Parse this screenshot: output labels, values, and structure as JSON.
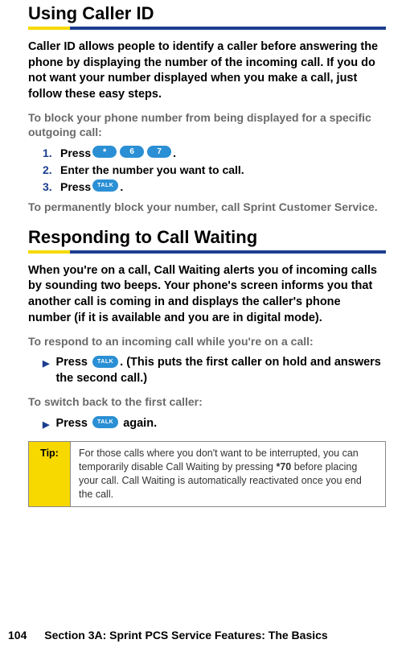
{
  "section1": {
    "heading": "Using Caller ID",
    "para": "Caller ID allows people to identify a caller before answering the phone by displaying the number of the incoming call. If you do not want your number displayed when you make a call, just follow these easy steps.",
    "subhead": "To block your phone number from being displayed for a specific outgoing call:",
    "steps": [
      {
        "num": "1.",
        "pre": "Press ",
        "keys": [
          "*",
          "6",
          "7"
        ],
        "post": "."
      },
      {
        "num": "2.",
        "pre": "Enter the number you want to call.",
        "keys": [],
        "post": ""
      },
      {
        "num": "3.",
        "pre": "Press ",
        "keys": [
          "TALK"
        ],
        "post": "."
      }
    ],
    "closing": "To permanently block your number, call Sprint Customer Service."
  },
  "section2": {
    "heading": "Responding to Call Waiting",
    "para": "When you're on a call, Call Waiting alerts you of incoming calls by sounding two beeps. Your phone's screen informs you that another call is coming in and displays the caller's phone number (if it is available and you are in digital mode).",
    "subhead1": "To respond to an incoming call while you're on a call:",
    "bullet1_pre": "Press ",
    "bullet1_key": "TALK",
    "bullet1_post": ". (This puts the first caller on hold and answers the second call.)",
    "subhead2": "To switch back to the first caller:",
    "bullet2_pre": "Press ",
    "bullet2_key": "TALK",
    "bullet2_post": " again."
  },
  "tip": {
    "label": "Tip:",
    "text_pre": "For those calls where you don't want to be interrupted, you can temporarily disable Call Waiting by pressing ",
    "code": "*70",
    "text_post": " before placing your call. Call Waiting is automatically reactivated once you end the call."
  },
  "footer": {
    "page": "104",
    "text": "Section 3A: Sprint PCS Service Features: The Basics"
  }
}
